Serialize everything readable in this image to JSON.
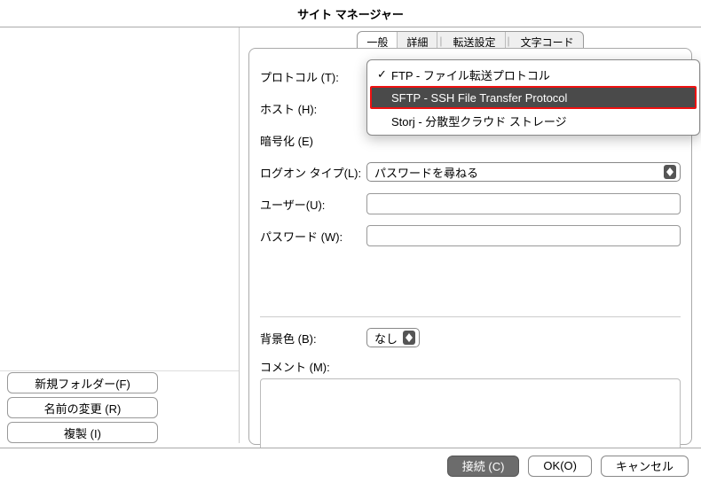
{
  "window": {
    "title": "サイト マネージャー"
  },
  "left": {
    "buttons": {
      "new_folder": "新規フォルダー(F)",
      "rename": "名前の変更 (R)",
      "duplicate": "複製 (I)"
    }
  },
  "tabs": {
    "general": "一般",
    "advanced": "詳細",
    "transfer": "転送設定",
    "charset": "文字コード"
  },
  "form": {
    "protocol_label": "プロトコル (T):",
    "host_label": "ホスト (H):",
    "encrypt_label": "暗号化 (E)",
    "logon_label": "ログオン タイプ(L):",
    "user_label": "ユーザー(U):",
    "password_label": "パスワード (W):",
    "bgcolor_label": "背景色 (B):",
    "comment_label": "コメント (M):",
    "logon_value": "パスワードを尋ねる",
    "bgcolor_value": "なし",
    "host_value": "",
    "user_value": "",
    "password_value": ""
  },
  "dropdown": {
    "items": [
      {
        "label": "FTP - ファイル転送プロトコル",
        "checked": true,
        "highlight": false
      },
      {
        "label": "SFTP - SSH File Transfer Protocol",
        "checked": false,
        "highlight": true
      },
      {
        "label": "Storj - 分散型クラウド ストレージ",
        "checked": false,
        "highlight": false
      }
    ]
  },
  "footer": {
    "connect": "接続 (C)",
    "ok": "OK(O)",
    "cancel": "キャンセル"
  }
}
